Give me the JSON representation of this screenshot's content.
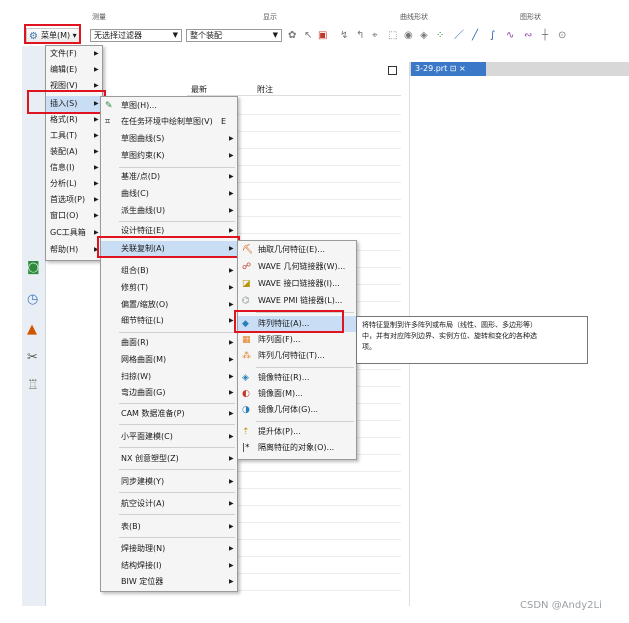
{
  "top_labels": [
    "测量",
    "显示",
    "曲线形状",
    "图形状"
  ],
  "toolbar": {
    "menu_label": "菜单(M) ▾",
    "filter_combo": "无选择过滤器",
    "assembly_combo": "整个装配"
  },
  "grid": {
    "col1": "最新",
    "col2": "附注"
  },
  "tab": {
    "label": "3-29.prt ⊡ ×"
  },
  "main_menu": [
    "文件(F)",
    "编辑(E)",
    "视图(V)",
    "插入(S)",
    "格式(R)",
    "工具(T)",
    "装配(A)",
    "信息(I)",
    "分析(L)",
    "首选项(P)",
    "窗口(O)",
    "GC工具箱",
    "帮助(H)"
  ],
  "insert_menu": [
    {
      "label": "草图(H)...",
      "arrow": false
    },
    {
      "label": "在任务环境中绘制草图(V)",
      "shortcut": "E",
      "arrow": false
    },
    {
      "label": "草图曲线(S)",
      "arrow": true
    },
    {
      "label": "草图约束(K)",
      "arrow": true
    },
    {
      "label": "基准/点(D)",
      "arrow": true
    },
    {
      "label": "曲线(C)",
      "arrow": true
    },
    {
      "label": "派生曲线(U)",
      "arrow": true
    },
    {
      "label": "设计特征(E)",
      "arrow": true
    },
    {
      "label": "关联复制(A)",
      "arrow": true
    },
    {
      "label": "组合(B)",
      "arrow": true
    },
    {
      "label": "修剪(T)",
      "arrow": true
    },
    {
      "label": "偏置/缩放(O)",
      "arrow": true
    },
    {
      "label": "细节特征(L)",
      "arrow": true
    },
    {
      "label": "曲面(R)",
      "arrow": true
    },
    {
      "label": "网格曲面(M)",
      "arrow": true
    },
    {
      "label": "扫掠(W)",
      "arrow": true
    },
    {
      "label": "弯边曲面(G)",
      "arrow": true
    },
    {
      "label": "CAM 数据准备(P)",
      "arrow": true
    },
    {
      "label": "小平面建模(C)",
      "arrow": true
    },
    {
      "label": "NX 创意塑型(Z)",
      "arrow": true
    },
    {
      "label": "同步建模(Y)",
      "arrow": true
    },
    {
      "label": "航空设计(A)",
      "arrow": true
    },
    {
      "label": "表(B)",
      "arrow": true
    },
    {
      "label": "焊接助理(N)",
      "arrow": true
    },
    {
      "label": "结构焊接(I)",
      "arrow": true
    },
    {
      "label": "BIW 定位器",
      "arrow": true
    }
  ],
  "assoc_menu": [
    "抽取几何特征(E)...",
    "WAVE 几何链接器(W)...",
    "WAVE 接口链接器(I)...",
    "WAVE PMI 链接器(L)...",
    "阵列特征(A)...",
    "阵列面(F)...",
    "阵列几何特征(T)...",
    "镜像特征(R)...",
    "镜像面(M)...",
    "镜像几何体(G)...",
    "提升体(P)...",
    "隔离特征的对象(O)..."
  ],
  "tooltip": {
    "line1": "将特征复制到许多阵列或布局（线性、圆形、多边形等）",
    "line2": "中，并有对应阵列边界、实例方位、旋转和变化的各种选",
    "line3": "项。"
  },
  "watermark": "CSDN @Andy2Li",
  "colors": {
    "highlight": "#c9def5",
    "red_box": "#e0141e",
    "tab_blue": "#3c78c8"
  }
}
